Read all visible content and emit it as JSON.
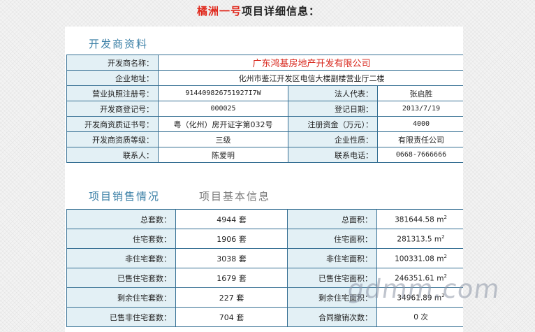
{
  "header": {
    "project_name": "橘洲一号",
    "title_suffix": "项目详细信息："
  },
  "developer": {
    "section_title": "开发商资料",
    "name_label": "开发商名称：",
    "name": "广东鸿基房地产开发有限公司",
    "address_label": "企业地址：",
    "address": "化州市鉴江开发区电信大楼副楼营业厅二楼",
    "license_label": "营业执照注册号：",
    "license": "914409826751927I7W",
    "legal_rep_label": "法人代表：",
    "legal_rep": "张启胜",
    "reg_no_label": "开发商登记号：",
    "reg_no": "000025",
    "reg_date_label": "登记日期：",
    "reg_date": "2013/7/19",
    "cert_label": "开发商资质证书号：",
    "cert": "粤（化州）房开证字第032号",
    "capital_label": "注册资金（万元）：",
    "capital": "4000",
    "grade_label": "开发商资质等级：",
    "grade": "三级",
    "nature_label": "企业性质：",
    "nature": "有限责任公司",
    "contact_label": "联系人：",
    "contact": "陈爱明",
    "phone_label": "联系电话：",
    "phone": "0668-7666666"
  },
  "tabs": {
    "sales": "项目销售情况",
    "basic": "项目基本信息"
  },
  "sales": {
    "area_unit": "m",
    "area_power": "2",
    "rows": [
      {
        "l1": "总套数：",
        "v1": "4944 套",
        "l2": "总面积：",
        "v2": "381644.58"
      },
      {
        "l1": "住宅套数：",
        "v1": "1906 套",
        "l2": "住宅面积：",
        "v2": "281313.5"
      },
      {
        "l1": "非住宅套数：",
        "v1": "3038 套",
        "l2": "非住宅面积：",
        "v2": "100331.08"
      },
      {
        "l1": "已售住宅套数：",
        "v1": "1679 套",
        "l2": "已售住宅面积：",
        "v2": "246351.61"
      },
      {
        "l1": "剩余住宅套数：",
        "v1": "227 套",
        "l2": "剩余住宅面积：",
        "v2": "34961.89"
      },
      {
        "l1": "已售非住宅套数：",
        "v1": "704 套",
        "l2": "合同撤销次数：",
        "v2": "0 次"
      }
    ]
  },
  "watermark": "gdmm.com"
}
